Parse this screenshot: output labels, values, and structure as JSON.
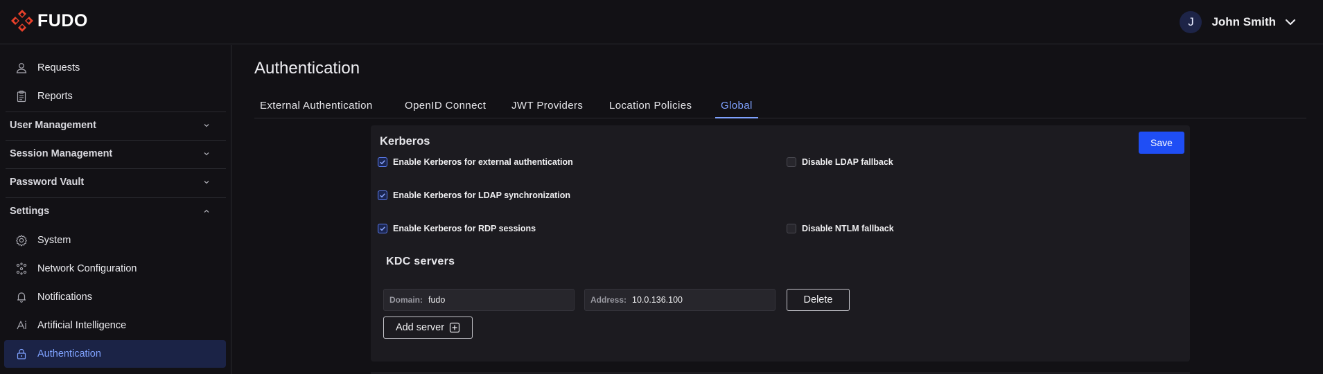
{
  "brand": {
    "name": "FUDO",
    "accent": "#e8402a"
  },
  "user": {
    "initial": "J",
    "name": "John Smith"
  },
  "sidebar": {
    "top_items": [
      {
        "label": "Requests",
        "icon": "person-icon"
      },
      {
        "label": "Reports",
        "icon": "clipboard-icon"
      }
    ],
    "groups": [
      {
        "label": "User Management",
        "expanded": false
      },
      {
        "label": "Session Management",
        "expanded": false
      },
      {
        "label": "Password Vault",
        "expanded": false
      },
      {
        "label": "Settings",
        "expanded": true
      }
    ],
    "settings_items": [
      {
        "label": "System",
        "icon": "gear-icon"
      },
      {
        "label": "Network Configuration",
        "icon": "network-icon"
      },
      {
        "label": "Notifications",
        "icon": "bell-icon"
      },
      {
        "label": "Artificial Intelligence",
        "icon": "ai-icon"
      },
      {
        "label": "Authentication",
        "icon": "lock-icon",
        "active": true
      }
    ]
  },
  "page": {
    "title": "Authentication",
    "tabs": [
      {
        "label": "External Authentication"
      },
      {
        "label": "OpenID Connect"
      },
      {
        "label": "JWT Providers"
      },
      {
        "label": "Location Policies"
      },
      {
        "label": "Global",
        "active": true
      }
    ]
  },
  "kerberos": {
    "title": "Kerberos",
    "save_label": "Save",
    "options": [
      {
        "label": "Enable Kerberos for external authentication",
        "checked": true
      },
      {
        "label": "Disable LDAP fallback",
        "checked": false
      },
      {
        "label": "Enable Kerberos for LDAP synchronization",
        "checked": true
      },
      {
        "label": "Enable Kerberos for RDP sessions",
        "checked": true
      },
      {
        "label": "Disable NTLM fallback",
        "checked": false
      }
    ],
    "kdc_title": "KDC servers",
    "server": {
      "domain_label": "Domain:",
      "domain_value": "fudo",
      "address_label": "Address:",
      "address_value": "10.0.136.100",
      "delete_label": "Delete"
    },
    "add_server_label": "Add server"
  },
  "colors": {
    "primary": "#1f4ef5",
    "active_text": "#7fa2ff",
    "active_bg": "#1b2346"
  }
}
